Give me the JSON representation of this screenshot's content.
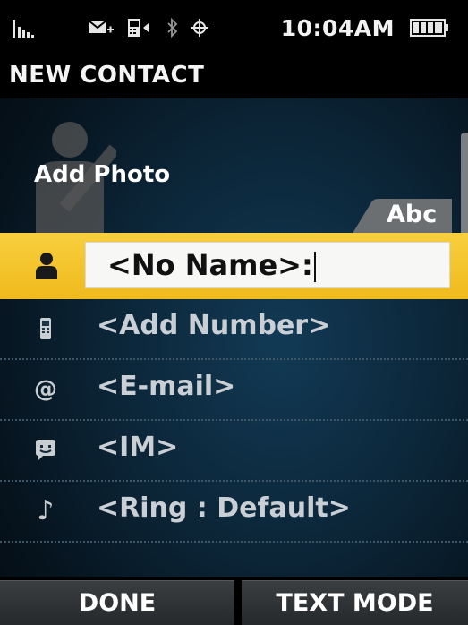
{
  "status_bar": {
    "time": "10:04AM",
    "icons": [
      "signal-icon",
      "message-icon",
      "phone-memory-icon",
      "bluetooth-icon",
      "gps-icon",
      "battery-icon"
    ]
  },
  "title_bar": {
    "title": "NEW CONTACT"
  },
  "photo": {
    "label": "Add Photo"
  },
  "input_mode": {
    "label": "Abc"
  },
  "fields": {
    "name": "<No Name>:",
    "number": "<Add Number>",
    "email": "<E-mail>",
    "im": "<IM>",
    "ring": "<Ring : Default>"
  },
  "softkeys": {
    "left": "DONE",
    "right": "TEXT MODE"
  },
  "colors": {
    "selection": "#f3c42c",
    "background": "#0b2436",
    "field_text": "#c9cfd4"
  }
}
